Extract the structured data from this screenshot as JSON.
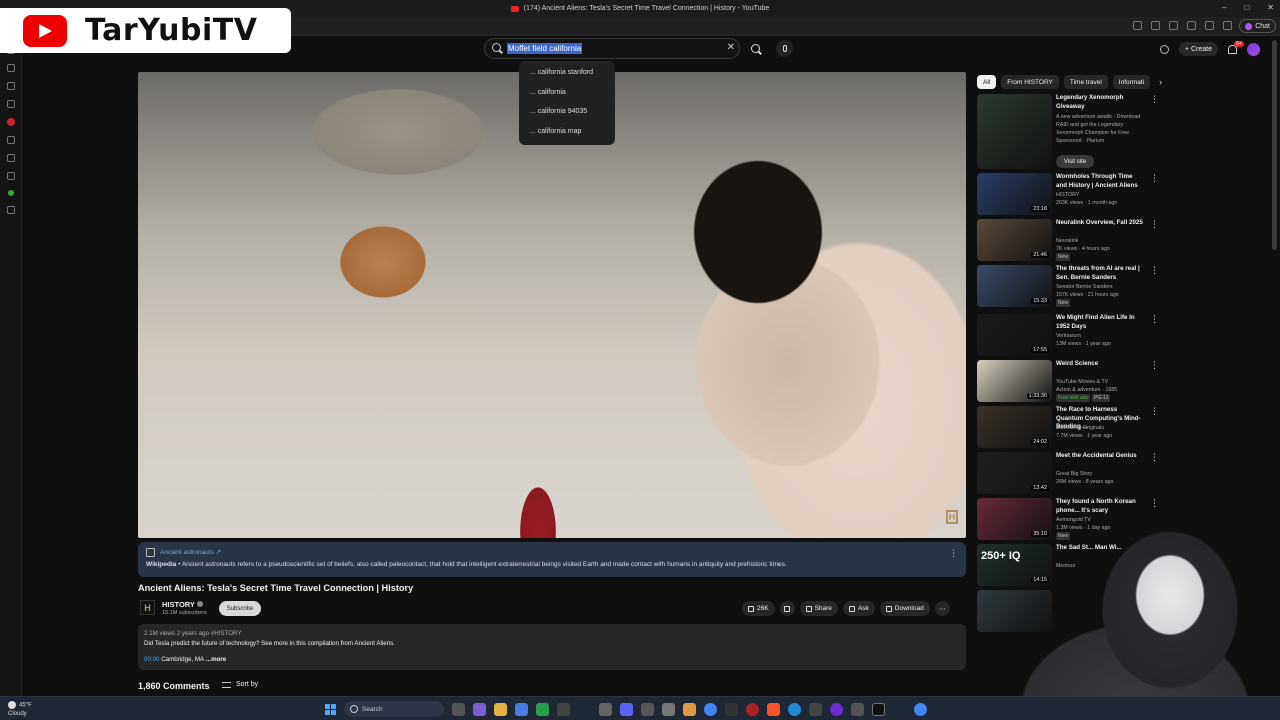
{
  "window": {
    "title": "(174) Ancient Aliens: Tesla's Secret Time Travel Connection | History - YouTube",
    "buttons": [
      "–",
      "□",
      "✕"
    ]
  },
  "browser": {
    "chat_label": "Chat"
  },
  "overlay_logo": {
    "text": "TarYubiTV"
  },
  "search": {
    "query": "Moffet field california",
    "clear": "✕",
    "suggestions": [
      "... california stanford",
      "... california",
      "... california 94035",
      "... california map"
    ]
  },
  "header": {
    "create_label": "Create",
    "notif_count": "9+"
  },
  "wiki_panel": {
    "link": "Ancient astronauts ↗",
    "source": "Wikipedia",
    "text": " • Ancient astronauts refers to a pseudoscientific set of beliefs, also called paleocontact, that hold that intelligent extraterrestrial beings visited Earth and made contact with humans in antiquity and prehistoric times.",
    "more": "⋮"
  },
  "video": {
    "title": "Ancient Aliens: Tesla's Secret Time Travel Connection | History",
    "watermark": "H",
    "channel": {
      "avatar": "H",
      "name": "HISTORY",
      "subscribers": "15.1M subscribers",
      "subscribe_label": "Subscribe"
    },
    "actions": {
      "likes": "26K",
      "share": "Share",
      "ask": "Ask",
      "download": "Download",
      "more": "⋯"
    },
    "description": {
      "views": "2.1M views",
      "age": "2 years ago",
      "tag": "#HISTORY",
      "line1": "Did Tesla predict the future of technology? See more in this compilation from Ancient Aliens.",
      "timestamp": "00:00",
      "location": " Cambridge, MA",
      "more": " ...more"
    }
  },
  "comments": {
    "count": "1,860 Comments",
    "sort_label": "Sort by"
  },
  "chips": [
    "All",
    "From HISTORY",
    "Time travel",
    "Informati"
  ],
  "recommendations": [
    {
      "title": "Legendary Xenomorph Giveaway",
      "sub1": "A new adventure awaits - Download RAID and get the Legendary Xenomorph Champion for Free",
      "sub2": "Sponsored · Plarium",
      "visit": "Visit site",
      "duration": "",
      "color": "#2c3a2e"
    },
    {
      "title": "Wormholes Through Time and History | Ancient Aliens",
      "sub1": "HISTORY",
      "sub2": "203K views · 1 month ago",
      "duration": "23:18",
      "color": "#2a3f6a"
    },
    {
      "title": "Neuralink Overview, Fall 2025",
      "sub1": "Neuralink",
      "sub2": "7K views · 4 hours ago",
      "badge": "New",
      "duration": "21:46",
      "color": "#5a4a3a"
    },
    {
      "title": "The threats from AI are real | Sen. Bernie Sanders",
      "sub1": "Senator Bernie Sanders",
      "sub2": "157K views · 21 hours ago",
      "badge": "New",
      "duration": "15:33",
      "color": "#3a4a6a"
    },
    {
      "title": "We Might Find Alien Life In 1952 Days",
      "sub1": "Veritasium",
      "sub2": "13M views · 1 year ago",
      "duration": "17:55",
      "color": "#1a1a1a"
    },
    {
      "title": "Weird Science",
      "sub1": "YouTube Movies & TV",
      "sub2": "Action & adventure · 1985",
      "badge_g": "Free with ads",
      "badge": "PG-13",
      "duration": "1:33:30",
      "color": "#d8d0c0"
    },
    {
      "title": "The Race to Harness Quantum Computing's Mind-Bending ...",
      "sub1": "Bloomberg Originals",
      "sub2": "7.7M views · 1 year ago",
      "duration": "24:02",
      "color": "#3a3028"
    },
    {
      "title": "Meet the Accidental Genius",
      "sub1": "Great Big Story",
      "sub2": "26M views · 8 years ago",
      "duration": "13:42",
      "color": "#202020"
    },
    {
      "title": "They found a North Korean phone... It's scary",
      "sub1": "Aemongold TV",
      "sub2": "1.3M views · 1 day ago",
      "badge": "New",
      "duration": "35:10",
      "color": "#6a2a3a"
    },
    {
      "title": "The Sad St... Man Wi...",
      "sub1": "Mentour",
      "sub2": "",
      "duration": "14:15",
      "thumb_text": "250+ IQ",
      "color": "#203028"
    },
    {
      "title": "",
      "sub1": "",
      "sub2": "",
      "duration": "",
      "color": "#303a40"
    }
  ],
  "taskbar": {
    "temp": "45°F",
    "weather": "Cloudy",
    "search_label": "Search"
  }
}
